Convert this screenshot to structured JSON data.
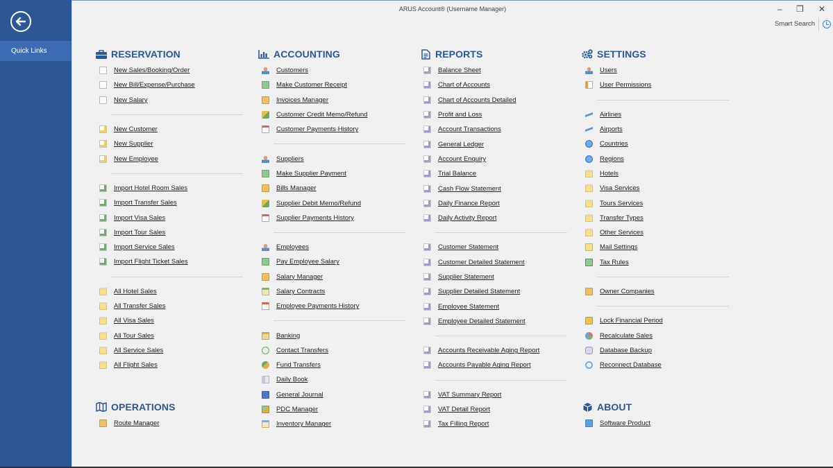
{
  "window": {
    "title": "ARUS Account® (Username Manager)",
    "minimize_label": "–",
    "restore_label": "❐",
    "close_label": "✕",
    "smart_search_label": "Smart Search"
  },
  "sidebar": {
    "back_icon": "arrow-left-circle-icon",
    "items": [
      {
        "label": "Quick Links",
        "active": true
      }
    ]
  },
  "colors": {
    "sidebar": "#2b5797",
    "sidebar_active": "#3c6cb4",
    "heading": "#2b5797",
    "background": "#f0f0f0"
  },
  "columns": [
    {
      "sections": [
        {
          "title": "RESERVATION",
          "icon": "briefcase-icon",
          "groups": [
            [
              {
                "label": "New Sales/Booking/Order",
                "icon": "doc"
              },
              {
                "label": "New Bill/Expense/Purchase",
                "icon": "doc"
              },
              {
                "label": "New Salary",
                "icon": "doc"
              }
            ],
            [
              {
                "label": "New Customer",
                "icon": "newdoc"
              },
              {
                "label": "New Supplier",
                "icon": "newdoc"
              },
              {
                "label": "New Employee",
                "icon": "newdoc"
              }
            ],
            [
              {
                "label": "Import Hotel Room Sales",
                "icon": "import"
              },
              {
                "label": "Import Transfer Sales",
                "icon": "import"
              },
              {
                "label": "Import Visa Sales",
                "icon": "import"
              },
              {
                "label": "Import Tour Sales",
                "icon": "import"
              },
              {
                "label": "Import Service Sales",
                "icon": "import"
              },
              {
                "label": "Import Flight Ticket Sales",
                "icon": "import"
              }
            ],
            [
              {
                "label": "All Hotel Sales",
                "icon": "folder"
              },
              {
                "label": "All Transfer Sales",
                "icon": "folder"
              },
              {
                "label": "All Visa Sales",
                "icon": "folder"
              },
              {
                "label": "All Tour Sales",
                "icon": "folder"
              },
              {
                "label": "All Service Sales",
                "icon": "folder"
              },
              {
                "label": "All Flight Sales",
                "icon": "folder"
              }
            ]
          ]
        },
        {
          "title": "OPERATIONS",
          "icon": "map-icon",
          "groups": [
            [
              {
                "label": "Route Manager",
                "icon": "case"
              }
            ]
          ]
        }
      ]
    },
    {
      "sections": [
        {
          "title": "ACCOUNTING",
          "icon": "bar-chart-icon",
          "groups": [
            [
              {
                "label": "Customers",
                "icon": "person"
              },
              {
                "label": "Make Customer Receipt",
                "icon": "money"
              },
              {
                "label": "Invoices Manager",
                "icon": "case"
              },
              {
                "label": "Customer Credit Memo/Refund",
                "icon": "memo"
              },
              {
                "label": "Customer Payments History",
                "icon": "history"
              }
            ],
            [
              {
                "label": "Suppliers",
                "icon": "person"
              },
              {
                "label": "Make Supplier Payment",
                "icon": "money"
              },
              {
                "label": "Bills Manager",
                "icon": "case"
              },
              {
                "label": "Supplier Debit Memo/Refund",
                "icon": "memo"
              },
              {
                "label": "Supplier Payments History",
                "icon": "history"
              }
            ],
            [
              {
                "label": "Employees",
                "icon": "person"
              },
              {
                "label": "Pay Employee Salary",
                "icon": "money"
              },
              {
                "label": "Salary Manager",
                "icon": "case"
              },
              {
                "label": "Salary Contracts",
                "icon": "contract"
              },
              {
                "label": "Employee Payments History",
                "icon": "history"
              }
            ],
            [
              {
                "label": "Banking",
                "icon": "bank"
              },
              {
                "label": "Contact Transfers",
                "icon": "coin"
              },
              {
                "label": "Fund Transfers",
                "icon": "fund"
              },
              {
                "label": "Daily Book",
                "icon": "book"
              },
              {
                "label": "General Journal",
                "icon": "journal"
              },
              {
                "label": "PDC Manager",
                "icon": "pdc"
              },
              {
                "label": "Inventory Manager",
                "icon": "inventory"
              }
            ]
          ]
        }
      ]
    },
    {
      "sections": [
        {
          "title": "REPORTS",
          "icon": "document-icon",
          "groups": [
            [
              {
                "label": "Balance Sheet",
                "icon": "report"
              },
              {
                "label": "Chart of Accounts",
                "icon": "report"
              },
              {
                "label": "Chart of Accounts Detailed",
                "icon": "report"
              },
              {
                "label": "Profit and Loss",
                "icon": "report"
              },
              {
                "label": "Account Transactions",
                "icon": "report"
              },
              {
                "label": "General Ledger",
                "icon": "report"
              },
              {
                "label": "Account Enquiry",
                "icon": "report"
              },
              {
                "label": "Trial Balance",
                "icon": "report"
              },
              {
                "label": "Cash Flow Statement",
                "icon": "report"
              },
              {
                "label": "Daily Finance Report",
                "icon": "report"
              },
              {
                "label": "Daily Activity Report",
                "icon": "report"
              }
            ],
            [
              {
                "label": "Customer Statement",
                "icon": "report"
              },
              {
                "label": "Customer Detailed Statement",
                "icon": "report"
              },
              {
                "label": "Supplier Statement",
                "icon": "report"
              },
              {
                "label": "Supplier Detailed Statement",
                "icon": "report"
              },
              {
                "label": "Employee Statement",
                "icon": "report"
              },
              {
                "label": "Employee Detailed Statement",
                "icon": "report"
              }
            ],
            [
              {
                "label": "Accounts Receivable Aging Report",
                "icon": "report"
              },
              {
                "label": "Accounts Payable Aging Report",
                "icon": "report"
              }
            ],
            [
              {
                "label": "VAT Summary Report",
                "icon": "report"
              },
              {
                "label": "VAT Detail Report",
                "icon": "report"
              },
              {
                "label": "Tax Filling Report",
                "icon": "report"
              }
            ]
          ]
        }
      ]
    },
    {
      "sections": [
        {
          "title": "SETTINGS",
          "icon": "gears-icon",
          "groups": [
            [
              {
                "label": "Users",
                "icon": "person"
              },
              {
                "label": "User Permissions",
                "icon": "perm"
              }
            ],
            [
              {
                "label": "Airlines",
                "icon": "plane"
              },
              {
                "label": "Airports",
                "icon": "plane"
              },
              {
                "label": "Countries",
                "icon": "globe"
              },
              {
                "label": "Regions",
                "icon": "globe"
              },
              {
                "label": "Hotels",
                "icon": "folder"
              },
              {
                "label": "Visa Services",
                "icon": "folder"
              },
              {
                "label": "Tours Services",
                "icon": "folder"
              },
              {
                "label": "Transfer Types",
                "icon": "folder"
              },
              {
                "label": "Other Services",
                "icon": "folder"
              },
              {
                "label": "Mail Settings",
                "icon": "mail"
              },
              {
                "label": "Tax Rules",
                "icon": "tax"
              }
            ],
            [
              {
                "label": "Owner Companies",
                "icon": "case"
              }
            ],
            [
              {
                "label": "Lock Financial Period",
                "icon": "lock"
              },
              {
                "label": "Recalculate Sales",
                "icon": "recalc"
              },
              {
                "label": "Database Backup",
                "icon": "db"
              },
              {
                "label": "Reconnect Database",
                "icon": "reconnect"
              }
            ]
          ]
        },
        {
          "title": "ABOUT",
          "icon": "cube-icon",
          "groups": [
            [
              {
                "label": "Software Product",
                "icon": "info"
              }
            ]
          ]
        }
      ]
    }
  ]
}
